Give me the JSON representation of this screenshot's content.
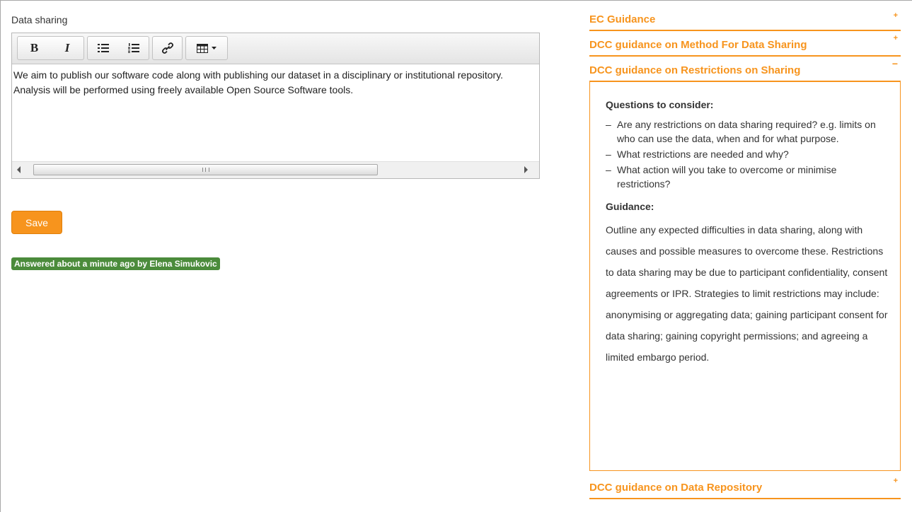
{
  "question": {
    "label": "Data sharing",
    "answer_text": "We aim to publish our software code along with publishing our dataset in a disciplinary or institutional repository. Analysis will be performed using freely available Open Source Software tools."
  },
  "toolbar": {
    "bold_label": "B",
    "italic_label": "I",
    "icons": [
      "bold-icon",
      "italic-icon",
      "bullet-list-icon",
      "numbered-list-icon",
      "link-icon",
      "table-icon"
    ]
  },
  "actions": {
    "save_label": "Save"
  },
  "status": {
    "answered_text": "Answered about a minute ago by Elena Simukovic",
    "color": "#4b8b3b"
  },
  "theme": {
    "accent": "#f7941d"
  },
  "guidance": {
    "sections": [
      {
        "title": "EC Guidance",
        "toggle": "+",
        "expanded": false
      },
      {
        "title": "DCC guidance on Method For Data Sharing",
        "toggle": "+",
        "expanded": false
      },
      {
        "title": "DCC guidance on Restrictions on Sharing",
        "toggle": "−",
        "expanded": true
      },
      {
        "title": "DCC guidance on Data Repository",
        "toggle": "+",
        "expanded": false
      }
    ],
    "panel": {
      "questions_heading": "Questions to consider:",
      "questions": [
        "Are any restrictions on data sharing required? e.g. limits on who can use the data, when and for what purpose.",
        "What restrictions are needed and why?",
        "What action will you take to overcome or minimise restrictions?"
      ],
      "guidance_heading": "Guidance:",
      "guidance_text": "Outline any expected difficulties in data sharing, along with causes and possible measures to overcome these. Restrictions to data sharing may be due to participant confidentiality, consent agreements or IPR. Strategies to limit restrictions may include: anonymising or aggregating data; gaining participant consent for data sharing; gaining copyright permissions; and agreeing a limited embargo period."
    }
  }
}
